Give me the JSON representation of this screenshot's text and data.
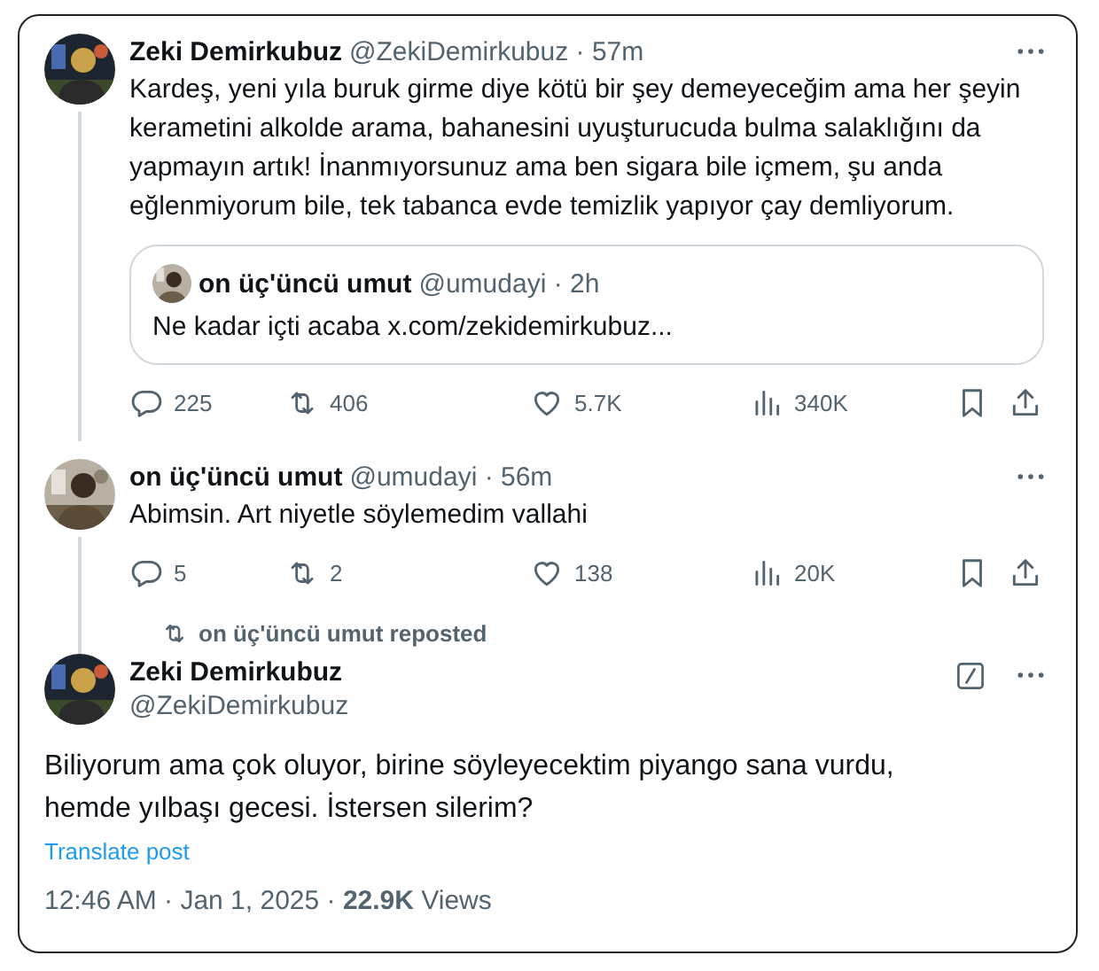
{
  "thread": [
    {
      "name": "Zeki Demirkubuz",
      "meta": "@ZekiDemirkubuz · 57m",
      "text": "Kardeş, yeni yıla buruk girme diye kötü bir şey demeyeceğim ama her şeyin kerametini alkolde arama, bahanesini uyuşturucuda bulma salaklığını da yapmayın artık! İnanmıyorsunuz ama ben sigara bile içmem, şu anda eğlenmiyorum bile, tek tabanca evde temizlik yapıyor çay demliyorum.",
      "quote": {
        "name": "on üç'üncü umut",
        "meta": "@umudayi · 2h",
        "text": "Ne kadar içti acaba x.com/zekidemirkubuz..."
      },
      "stats": {
        "replies": "225",
        "reposts": "406",
        "likes": "5.7K",
        "views": "340K"
      }
    },
    {
      "name": "on üç'üncü umut",
      "meta": "@umudayi · 56m",
      "text": "Abimsin. Art niyetle söylemedim vallahi",
      "stats": {
        "replies": "5",
        "reposts": "2",
        "likes": "138",
        "views": "20K"
      }
    }
  ],
  "repost_note": "on üç'üncü umut reposted",
  "main": {
    "name": "Zeki Demirkubuz",
    "handle": "@ZekiDemirkubuz",
    "text": "Biliyorum ama çok oluyor, birine söyleyecektim piyango sana vurdu, hemde yılbaşı gecesi. İstersen silerim?",
    "translate": "Translate post",
    "meta": "12:46 AM · Jan 1, 2025 · **22.9K** Views"
  }
}
